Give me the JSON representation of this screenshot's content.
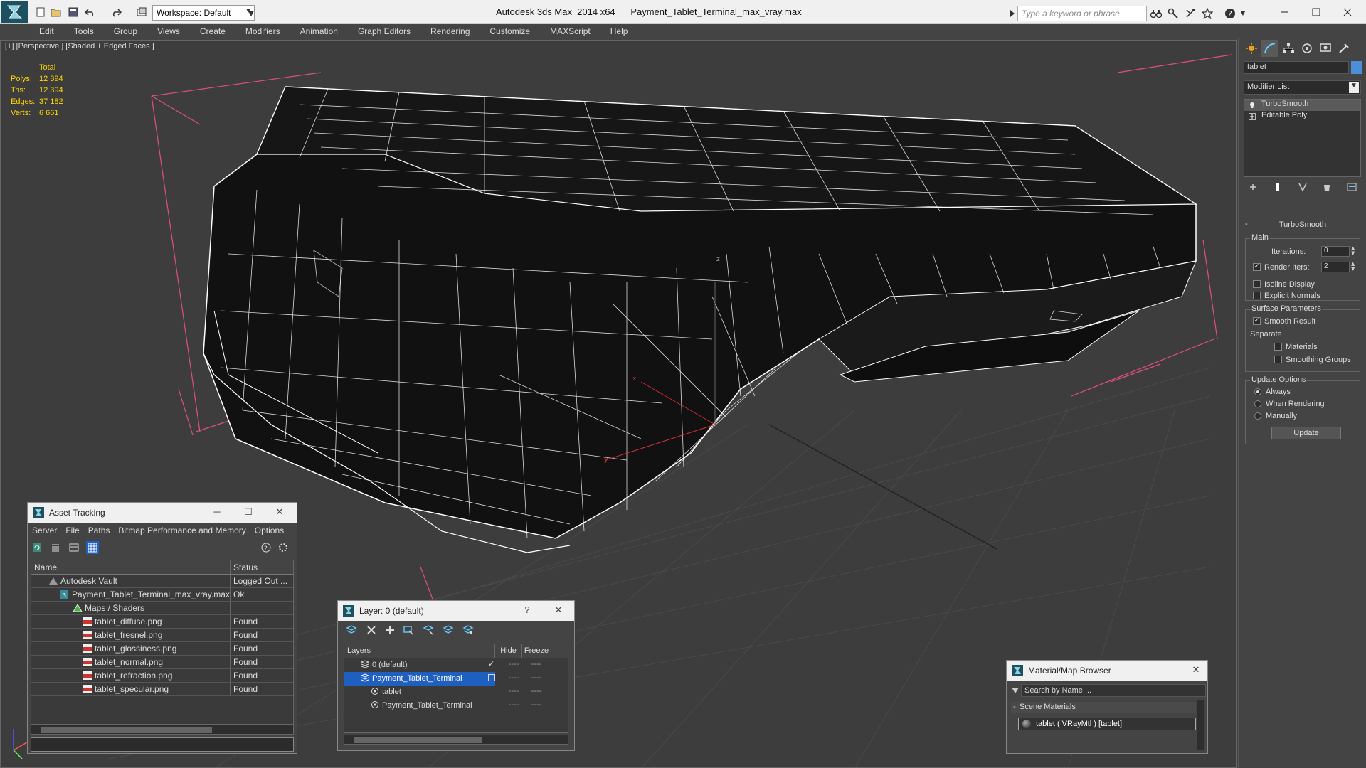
{
  "titlebar": {
    "workspace": "Workspace: Default",
    "app_title": "Autodesk 3ds Max  2014 x64      Payment_Tablet_Terminal_max_vray.max",
    "search_placeholder": "Type a keyword or phrase"
  },
  "menu": [
    "Edit",
    "Tools",
    "Group",
    "Views",
    "Create",
    "Modifiers",
    "Animation",
    "Graph Editors",
    "Rendering",
    "Customize",
    "MAXScript",
    "Help"
  ],
  "viewport": {
    "label": "[+] [Perspective ] [Shaded + Edged Faces ]",
    "stats": {
      "header": "Total",
      "rows": [
        {
          "label": "Polys:",
          "value": "12 394"
        },
        {
          "label": "Tris:",
          "value": "12 394"
        },
        {
          "label": "Edges:",
          "value": "37 182"
        },
        {
          "label": "Verts:",
          "value": "6 661"
        }
      ]
    }
  },
  "command_panel": {
    "object_name": "tablet",
    "modifier_list": "Modifier List",
    "stack": [
      {
        "label": "TurboSmooth",
        "selected": true
      },
      {
        "label": "Editable Poly",
        "selected": false
      }
    ],
    "turbosmooth": {
      "title": "TurboSmooth",
      "main_group": "Main",
      "iterations_label": "Iterations:",
      "iterations_value": "0",
      "render_iters_label": "Render Iters:",
      "render_iters_value": "2",
      "isoline_label": "Isoline Display",
      "explicit_normals_label": "Explicit Normals",
      "surface_group": "Surface Parameters",
      "smooth_result_label": "Smooth Result",
      "separate_label": "Separate",
      "materials_label": "Materials",
      "smoothing_groups_label": "Smoothing Groups",
      "update_group": "Update Options",
      "always_label": "Always",
      "when_rendering_label": "When Rendering",
      "manually_label": "Manually",
      "update_button": "Update"
    }
  },
  "asset_tracking": {
    "title": "Asset Tracking",
    "menu": [
      "Server",
      "File",
      "Paths",
      "Bitmap Performance and Memory",
      "Options"
    ],
    "columns": [
      "Name",
      "Status"
    ],
    "rows": [
      {
        "name": "Autodesk Vault",
        "status": "Logged Out ...",
        "level": 1,
        "icon": "vault"
      },
      {
        "name": "Payment_Tablet_Terminal_max_vray.max",
        "status": "Ok",
        "level": 2,
        "icon": "max"
      },
      {
        "name": "Maps / Shaders",
        "status": "",
        "level": 3,
        "icon": "maps"
      },
      {
        "name": "tablet_diffuse.png",
        "status": "Found",
        "level": 4,
        "icon": "png"
      },
      {
        "name": "tablet_fresnel.png",
        "status": "Found",
        "level": 4,
        "icon": "png"
      },
      {
        "name": "tablet_glossiness.png",
        "status": "Found",
        "level": 4,
        "icon": "png"
      },
      {
        "name": "tablet_normal.png",
        "status": "Found",
        "level": 4,
        "icon": "png"
      },
      {
        "name": "tablet_refraction.png",
        "status": "Found",
        "level": 4,
        "icon": "png"
      },
      {
        "name": "tablet_specular.png",
        "status": "Found",
        "level": 4,
        "icon": "png"
      }
    ]
  },
  "layer_window": {
    "title": "Layer: 0 (default)",
    "help": "?",
    "columns": [
      "Layers",
      "Hide",
      "Freeze"
    ],
    "rows": [
      {
        "name": "0 (default)",
        "level": 1,
        "selected": false,
        "current": true
      },
      {
        "name": "Payment_Tablet_Terminal",
        "level": 1,
        "selected": true,
        "current": false
      },
      {
        "name": "tablet",
        "level": 2,
        "selected": false,
        "current": false
      },
      {
        "name": "Payment_Tablet_Terminal",
        "level": 2,
        "selected": false,
        "current": false
      }
    ],
    "dash": "----"
  },
  "material_browser": {
    "title": "Material/Map Browser",
    "search_placeholder": "Search by Name ...",
    "section": "Scene Materials",
    "section_toggle": "-",
    "item": "tablet  ( VRayMtl )  [tablet]"
  },
  "colors": {
    "viewport_bg": "#3d3d3d",
    "wire": "#ffffff",
    "selection": "#1f5fbf",
    "stats_text": "#ffd700",
    "guide_lines": "#e0507a"
  }
}
